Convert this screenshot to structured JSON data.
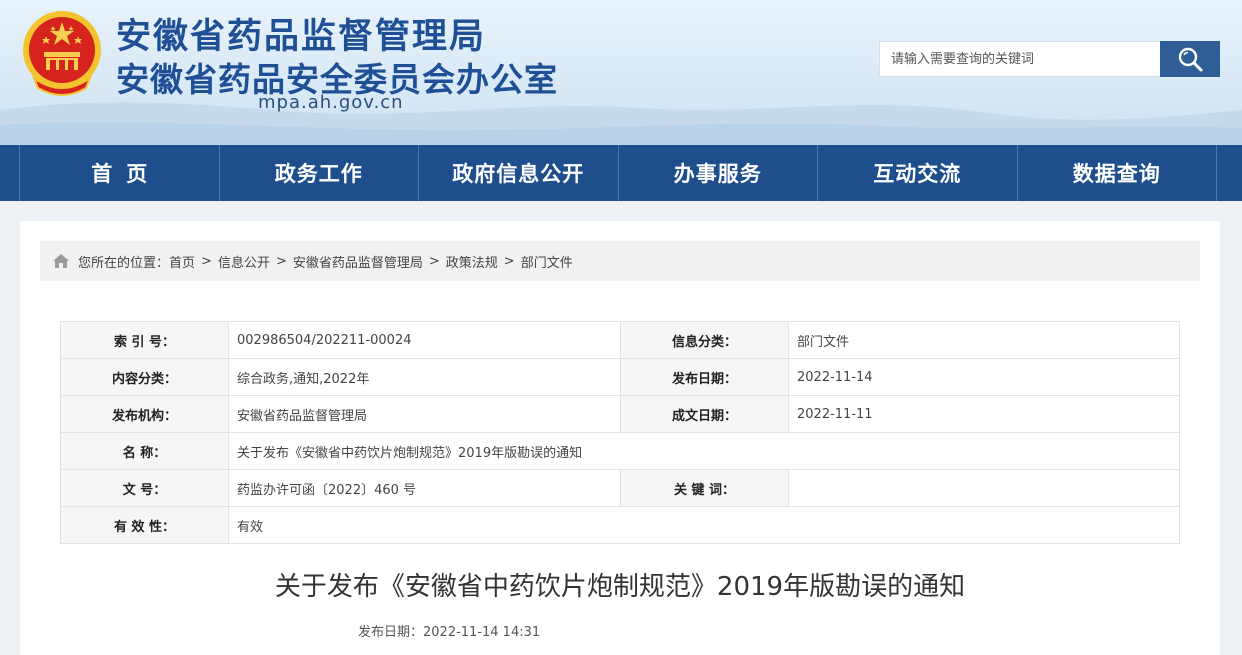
{
  "header": {
    "title_line1": "安徽省药品监督管理局",
    "title_line2": "安徽省药品安全委员会办公室",
    "domain": "mpa.ah.gov.cn",
    "search_placeholder": "请输入需要查询的关键词",
    "search_icon": "search-icon",
    "emblem": "national-emblem"
  },
  "nav": {
    "items": [
      {
        "label": "首页"
      },
      {
        "label": "政务工作"
      },
      {
        "label": "政府信息公开"
      },
      {
        "label": "办事服务"
      },
      {
        "label": "互动交流"
      },
      {
        "label": "数据查询"
      }
    ]
  },
  "breadcrumb": {
    "prefix": "您所在的位置：",
    "items": [
      "首页",
      "信息公开",
      "安徽省药品监督管理局",
      "政策法规",
      "部门文件"
    ],
    "separator": ">",
    "icon": "home-icon"
  },
  "meta": {
    "index_label": "索 引 号：",
    "index_value": "002986504/202211-00024",
    "category_label": "信息分类：",
    "category_value": "部门文件",
    "content_label": "内容分类：",
    "content_value": "综合政务,通知,2022年",
    "pubdate_label": "发布日期：",
    "pubdate_value": "2022-11-14",
    "org_label": "发布机构：",
    "org_value": "安徽省药品监督管理局",
    "created_label": "成文日期：",
    "created_value": "2022-11-11",
    "name_label": "名 称：",
    "name_value": "关于发布《安徽省中药饮片炮制规范》2019年版勘误的通知",
    "docno_label": "文 号：",
    "docno_value": "药监办许可函〔2022〕460 号",
    "keyword_label": "关 键 词：",
    "keyword_value": "",
    "validity_label": "有 效 性：",
    "validity_value": "有效"
  },
  "article": {
    "title": "关于发布《安徽省中药饮片炮制规范》2019年版勘误的通知",
    "pubdate": "发布日期：2022-11-14 14:31"
  },
  "colors": {
    "brand_blue": "#1e4f8c",
    "title_blue": "#1f4f95",
    "search_btn": "#2f5e96"
  }
}
